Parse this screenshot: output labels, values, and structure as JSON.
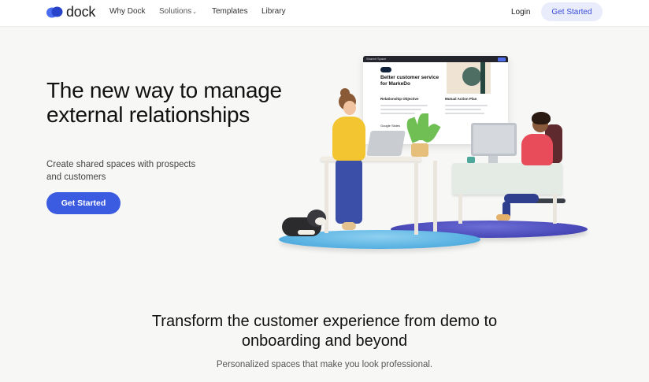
{
  "header": {
    "logo_text": "dock",
    "nav": {
      "why": "Why Dock",
      "solutions": "Solutions",
      "templates": "Templates",
      "library": "Library"
    },
    "login": "Login",
    "cta": "Get Started"
  },
  "hero": {
    "title": "The new way to manage external relationships",
    "subtitle": "Create shared spaces with prospects and customers",
    "cta": "Get Started"
  },
  "illustration": {
    "screen_bar_label": "Shared Space",
    "screen_title": "Better customer service for MarkeDo",
    "col1_label": "Relationship Objective",
    "col2_label": "Mutual Action Plan",
    "attachment_label": "Google Slides"
  },
  "section": {
    "title": "Transform the customer experience from demo to onboarding and beyond",
    "subtitle": "Personalized spaces that make you look professional."
  },
  "colors": {
    "brand": "#3b5be0",
    "brand_light": "#e9ecfb",
    "background": "#f7f7f6"
  },
  "icons": {
    "logo": "dock-logo-icon",
    "solutions_dropdown": "chevron-down-icon"
  }
}
